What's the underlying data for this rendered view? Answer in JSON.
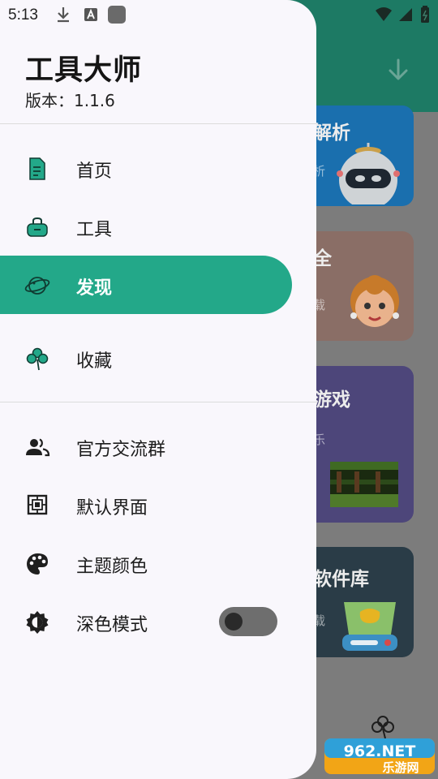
{
  "status_bar": {
    "time": "5:13",
    "icons": [
      "download-icon",
      "a-badge-icon",
      "app-square-icon",
      "wifi-icon",
      "signal-icon",
      "battery-icon"
    ]
  },
  "drawer": {
    "app_title": "工具大师",
    "version": "版本：1.1.6",
    "primary_items": [
      {
        "label": "首页",
        "icon": "document-icon",
        "active": false
      },
      {
        "label": "工具",
        "icon": "toolbox-icon",
        "active": false
      },
      {
        "label": "发现",
        "icon": "planet-icon",
        "active": true
      },
      {
        "label": "收藏",
        "icon": "clover-icon",
        "active": false
      }
    ],
    "secondary_items": [
      {
        "label": "官方交流群",
        "icon": "group-icon"
      },
      {
        "label": "默认界面",
        "icon": "default-screen-icon"
      },
      {
        "label": "主题颜色",
        "icon": "palette-icon"
      },
      {
        "label": "深色模式",
        "icon": "dark-mode-icon"
      }
    ],
    "dark_mode_on": false,
    "accent_color": "#23a889"
  },
  "background": {
    "cards": [
      {
        "title": "解析",
        "subtitle": "析"
      },
      {
        "title": "全",
        "subtitle": "载"
      },
      {
        "title": "游戏",
        "subtitle": "乐"
      },
      {
        "title": "软件库",
        "subtitle": "载"
      }
    ],
    "watermark": {
      "line1": "962.NET",
      "line2": "乐游网"
    }
  }
}
